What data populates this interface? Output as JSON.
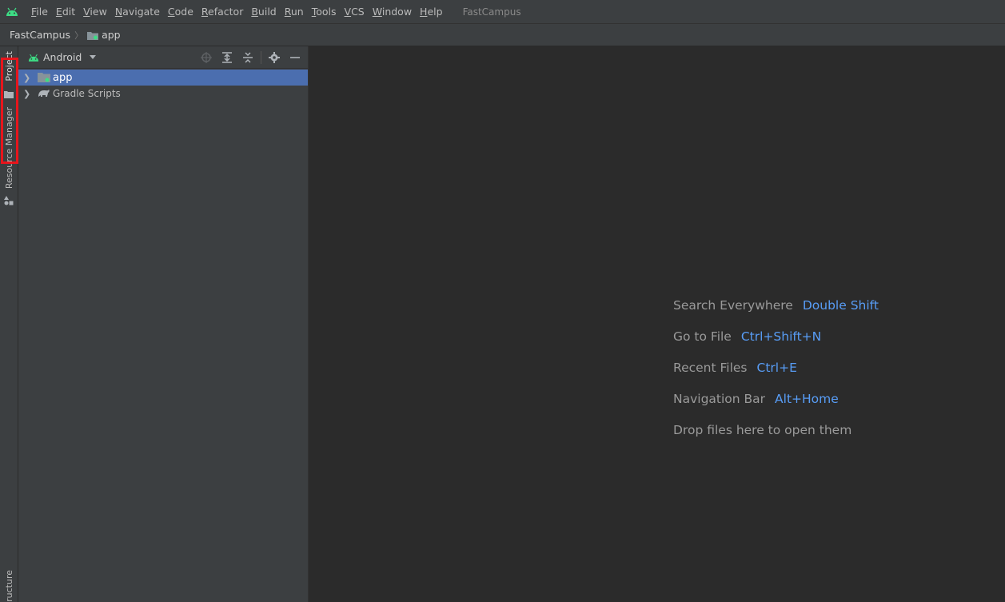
{
  "menubar": {
    "items": [
      "File",
      "Edit",
      "View",
      "Navigate",
      "Code",
      "Refactor",
      "Build",
      "Run",
      "Tools",
      "VCS",
      "Window",
      "Help"
    ],
    "project_title": "FastCampus",
    "logo_icon": "android-icon"
  },
  "navbar": {
    "root": "FastCampus",
    "module": "app"
  },
  "toolstrip": {
    "project_tab": "Project",
    "resource_manager_tab": "Resource Manager",
    "structure_tab": "ructure"
  },
  "project_panel": {
    "view_mode": "Android",
    "tree": [
      {
        "label": "app",
        "icon": "module-folder-icon",
        "selected": true
      },
      {
        "label": "Gradle Scripts",
        "icon": "gradle-icon",
        "selected": false
      }
    ]
  },
  "editor": {
    "hints": [
      {
        "action": "Search Everywhere",
        "shortcut": "Double Shift"
      },
      {
        "action": "Go to File",
        "shortcut": "Ctrl+Shift+N"
      },
      {
        "action": "Recent Files",
        "shortcut": "Ctrl+E"
      },
      {
        "action": "Navigation Bar",
        "shortcut": "Alt+Home"
      },
      {
        "action": "Drop files here to open them",
        "shortcut": ""
      }
    ]
  },
  "colors": {
    "accent_shortcut": "#589df6",
    "selection": "#4b6eaf",
    "highlight_box": "#e8151c",
    "android_green": "#3ddc84"
  }
}
